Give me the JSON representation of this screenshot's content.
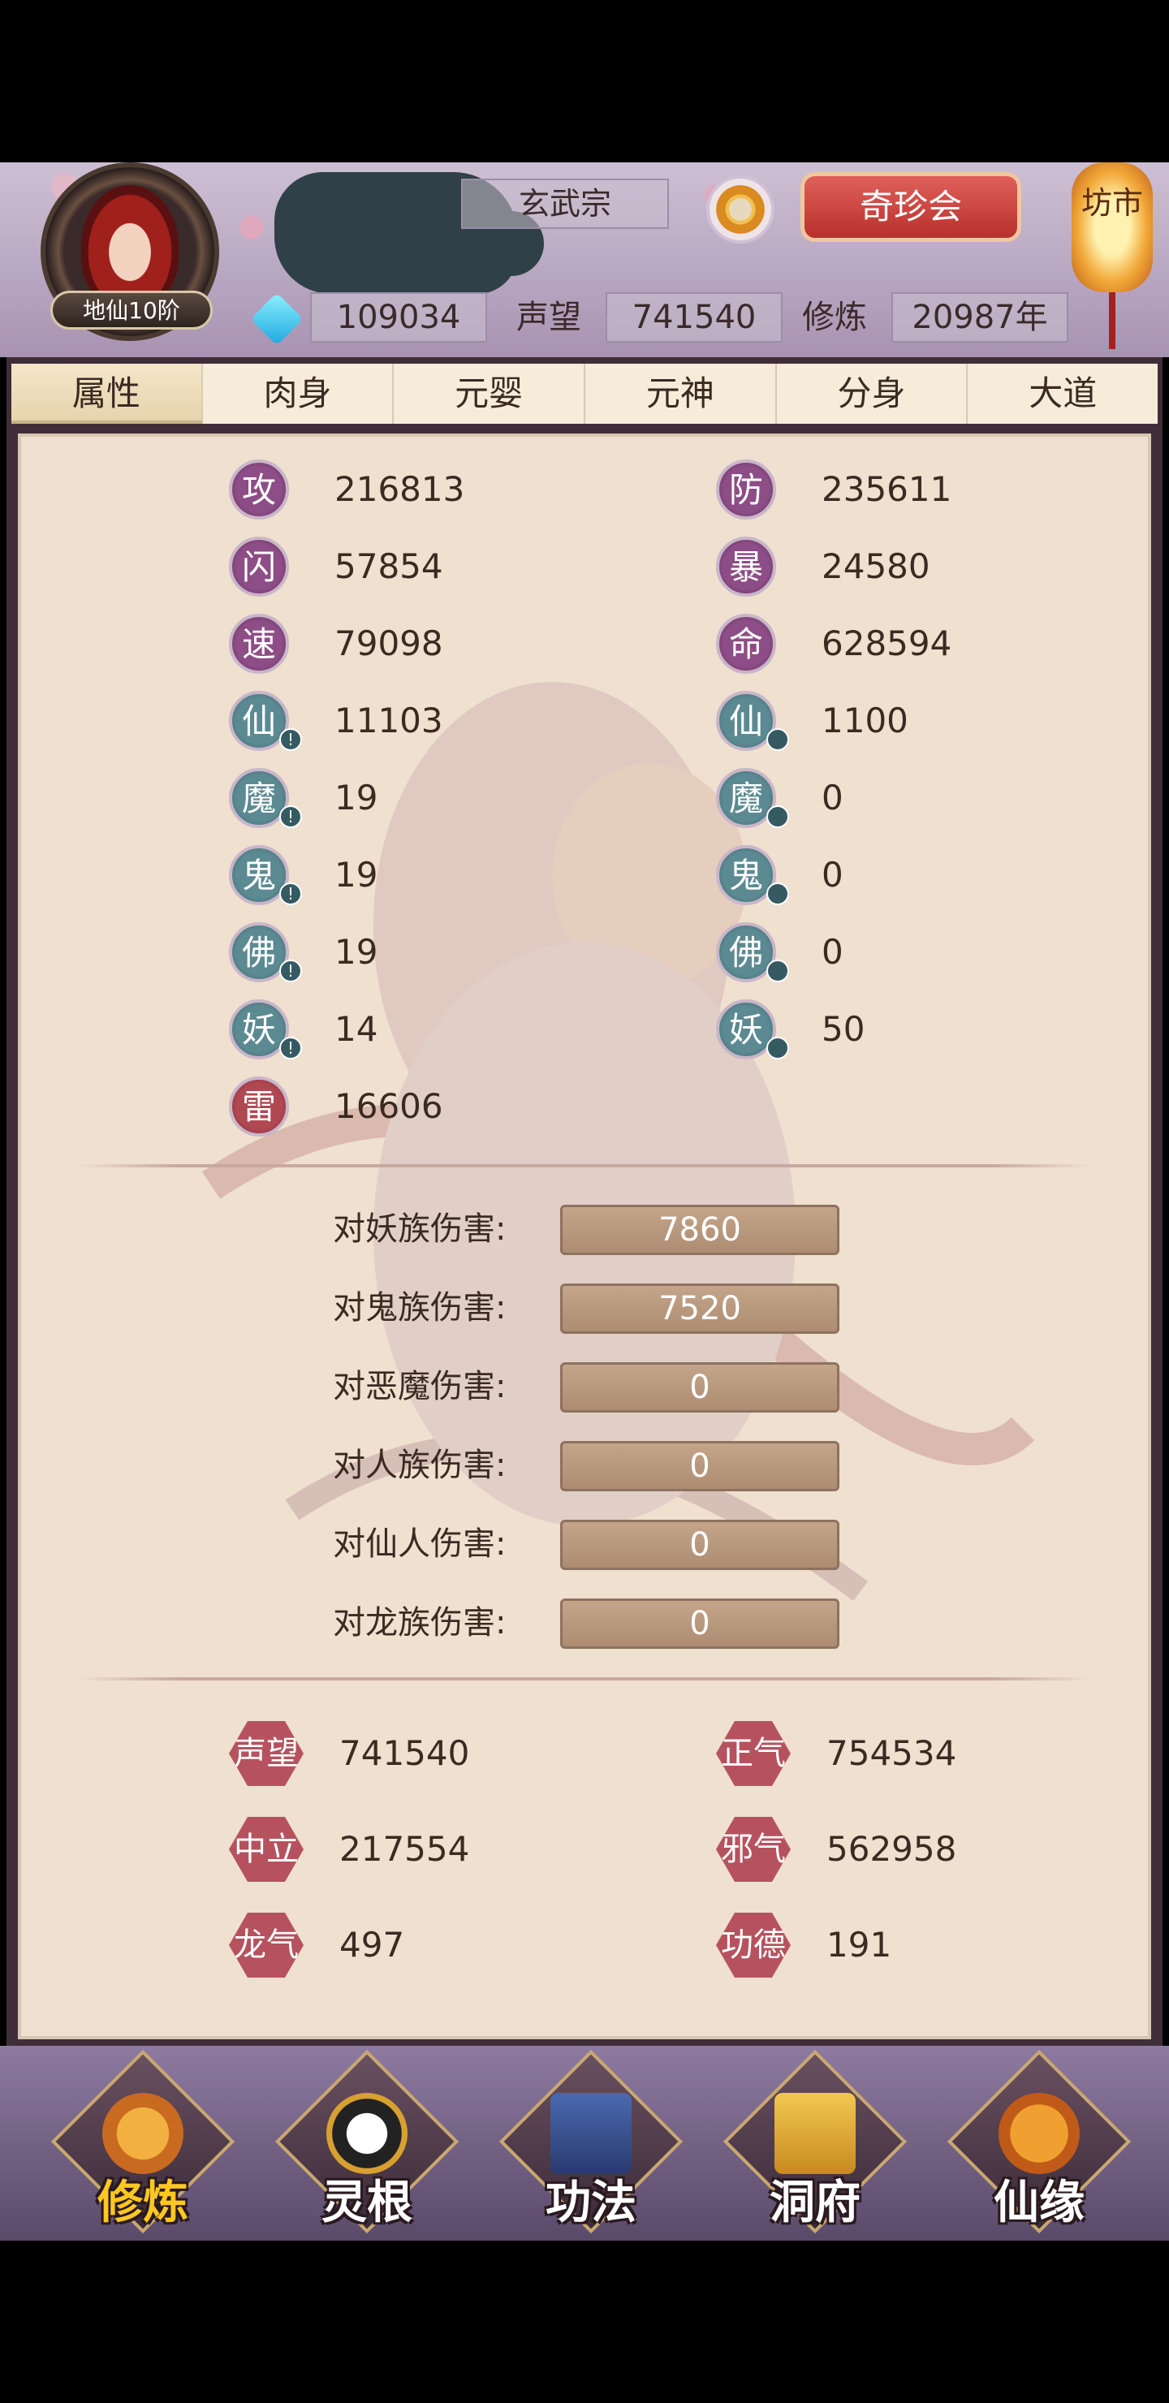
{
  "header": {
    "rank_badge": "地仙10阶",
    "sect_name": "玄武宗",
    "market_button": "奇珍会",
    "lantern_text": "坊市",
    "spirit_stones": "109034",
    "reputation_label": "声望",
    "reputation_value": "741540",
    "cultivation_label": "修炼",
    "cultivation_value": "20987年"
  },
  "tabs": [
    "属性",
    "肉身",
    "元婴",
    "元神",
    "分身",
    "大道"
  ],
  "attributes": {
    "left": [
      {
        "icon": "攻",
        "value": "216813"
      },
      {
        "icon": "闪",
        "value": "57854"
      },
      {
        "icon": "速",
        "value": "79098"
      },
      {
        "icon": "仙",
        "value": "11103"
      },
      {
        "icon": "魔",
        "value": "19"
      },
      {
        "icon": "鬼",
        "value": "19"
      },
      {
        "icon": "佛",
        "value": "19"
      },
      {
        "icon": "妖",
        "value": "14"
      },
      {
        "icon": "雷",
        "value": "16606"
      }
    ],
    "right": [
      {
        "icon": "防",
        "value": "235611"
      },
      {
        "icon": "暴",
        "value": "24580"
      },
      {
        "icon": "命",
        "value": "628594"
      },
      {
        "icon": "仙",
        "value": "1100"
      },
      {
        "icon": "魔",
        "value": "0"
      },
      {
        "icon": "鬼",
        "value": "0"
      },
      {
        "icon": "佛",
        "value": "0"
      },
      {
        "icon": "妖",
        "value": "50"
      }
    ]
  },
  "damage": [
    {
      "label": "对妖族伤害:",
      "value": "7860"
    },
    {
      "label": "对鬼族伤害:",
      "value": "7520"
    },
    {
      "label": "对恶魔伤害:",
      "value": "0"
    },
    {
      "label": "对人族伤害:",
      "value": "0"
    },
    {
      "label": "对仙人伤害:",
      "value": "0"
    },
    {
      "label": "对龙族伤害:",
      "value": "0"
    }
  ],
  "reputation": {
    "left": [
      {
        "label": "声望",
        "value": "741540"
      },
      {
        "label": "中立",
        "value": "217554"
      },
      {
        "label": "龙气",
        "value": "497"
      }
    ],
    "right": [
      {
        "label": "正气",
        "value": "754534"
      },
      {
        "label": "邪气",
        "value": "562958"
      },
      {
        "label": "功德",
        "value": "191"
      }
    ]
  },
  "nav": [
    "修炼",
    "灵根",
    "功法",
    "洞府",
    "仙缘"
  ]
}
